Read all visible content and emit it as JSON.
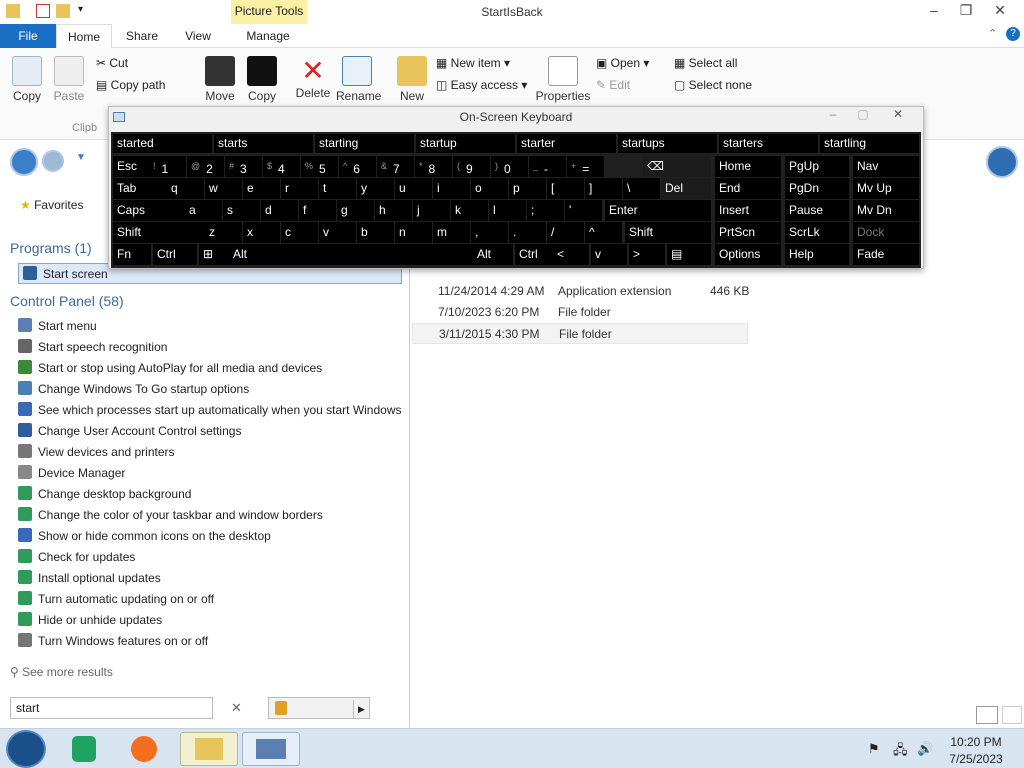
{
  "window": {
    "title": "StartIsBack",
    "contextual_tab": "Picture Tools"
  },
  "tabs": [
    "File",
    "Home",
    "Share",
    "View",
    "Manage"
  ],
  "ribbon": {
    "copy": "Copy",
    "paste": "Paste",
    "cut": "Cut",
    "copy_path": "Copy path",
    "clipboard_group": "Clipb",
    "move": "Move",
    "copy_to": "Copy",
    "delete": "Delete",
    "rename": "Rename",
    "new": "New",
    "new_item": "New item",
    "easy_access": "Easy access",
    "properties": "Properties",
    "open": "Open",
    "edit": "Edit",
    "select_all": "Select all",
    "select_none": "Select none"
  },
  "nav": {
    "favorites": "Favorites"
  },
  "files": [
    {
      "date": "11/24/2014 4:29 AM",
      "type": "Application extension",
      "size": "446 KB"
    },
    {
      "date": "7/10/2023 6:20 PM",
      "type": "File folder",
      "size": ""
    },
    {
      "date": "3/11/2015 4:30 PM",
      "type": "File folder",
      "size": ""
    }
  ],
  "start_menu": {
    "programs_heading": "Programs (1)",
    "programs": [
      "Start screen"
    ],
    "control_panel_heading": "Control Panel (58)",
    "control_panel": [
      "Start menu",
      "Start speech recognition",
      "Start or stop using AutoPlay for all media and devices",
      "Change Windows To Go startup options",
      "See which processes start up automatically when you start Windows",
      "Change User Account Control settings",
      "View devices and printers",
      "Device Manager",
      "Change desktop background",
      "Change the color of your taskbar and window borders",
      "Show or hide common icons on the desktop",
      "Check for updates",
      "Install optional updates",
      "Turn automatic updating on or off",
      "Hide or unhide updates",
      "Turn Windows features on or off"
    ],
    "see_more": "See more results",
    "search_value": "start"
  },
  "osk": {
    "title": "On-Screen Keyboard",
    "suggestions": [
      "started",
      "starts",
      "starting",
      "startup",
      "starter",
      "startups",
      "starters",
      "startling"
    ],
    "row1": [
      "Esc",
      "1",
      "2",
      "3",
      "4",
      "5",
      "6",
      "7",
      "8",
      "9",
      "0",
      "-",
      "=",
      "Home",
      "PgUp",
      "Nav"
    ],
    "row1_sub": [
      "`",
      "!",
      "@",
      "#",
      "$",
      "%",
      "^",
      "&",
      "*",
      "(",
      ")",
      "_",
      "+"
    ],
    "row2": [
      "Tab",
      "q",
      "w",
      "e",
      "r",
      "t",
      "y",
      "u",
      "i",
      "o",
      "p",
      "[",
      "]",
      "\\",
      "Del",
      "End",
      "PgDn",
      "Mv Up"
    ],
    "row3": [
      "Caps",
      "a",
      "s",
      "d",
      "f",
      "g",
      "h",
      "j",
      "k",
      "l",
      ";",
      "'",
      "Enter",
      "Insert",
      "Pause",
      "Mv Dn"
    ],
    "row4": [
      "Shift",
      "z",
      "x",
      "c",
      "v",
      "b",
      "n",
      "m",
      ",",
      ".",
      "/",
      "^",
      "Shift",
      "PrtScn",
      "ScrLk",
      "Dock"
    ],
    "row5": [
      "Fn",
      "Ctrl",
      "Alt",
      "Alt",
      "Ctrl",
      "<",
      "v",
      ">",
      "Options",
      "Help",
      "Fade"
    ]
  },
  "taskbar": {
    "time": "10:20 PM",
    "date": "7/25/2023"
  }
}
